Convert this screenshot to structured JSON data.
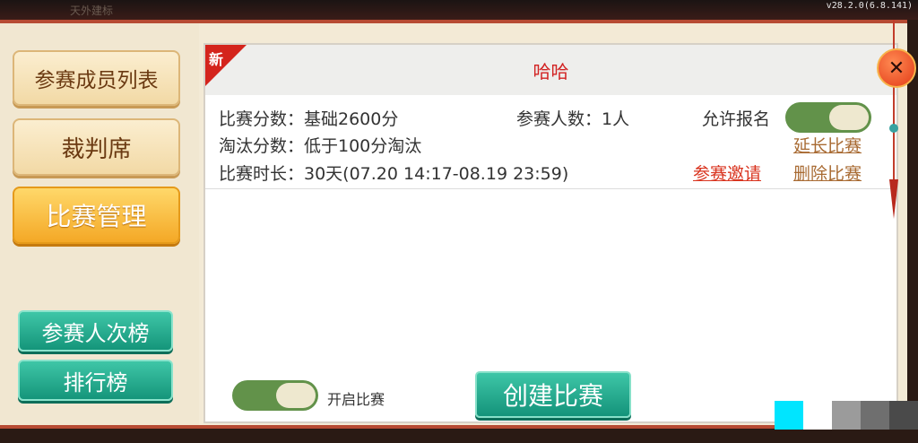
{
  "top": {
    "faint_text": "天外建标",
    "version": "v28.2.0(6.8.141)"
  },
  "sidebar": {
    "items": [
      {
        "label": "参赛成员列表",
        "active": false
      },
      {
        "label": "裁判席",
        "active": false
      },
      {
        "label": "比赛管理",
        "active": true
      }
    ],
    "bottom": [
      {
        "label": "参赛人次榜"
      },
      {
        "label": "排行榜"
      }
    ]
  },
  "match": {
    "tag": "新",
    "title": "哈哈",
    "score": "比赛分数：基础2600分",
    "players": "参赛人数：1人",
    "allow_signup_label": "允许报名",
    "allow_signup_on": true,
    "elimination": "淘汰分数：低于100分淘汰",
    "duration": "比赛时长：30天(07.20 14:17-08.19 23:59)",
    "invite_link": "参赛邀请",
    "extend_link": "延长比赛",
    "delete_link": "删除比赛"
  },
  "footer": {
    "start_label": "开启比赛",
    "start_on": true,
    "create_button": "创建比赛"
  },
  "close_icon": "close-icon",
  "colors": {
    "accent_red": "#d22222",
    "teal": "#1fa88a",
    "gold": "#f4a826",
    "toggle_green": "#62924a"
  }
}
